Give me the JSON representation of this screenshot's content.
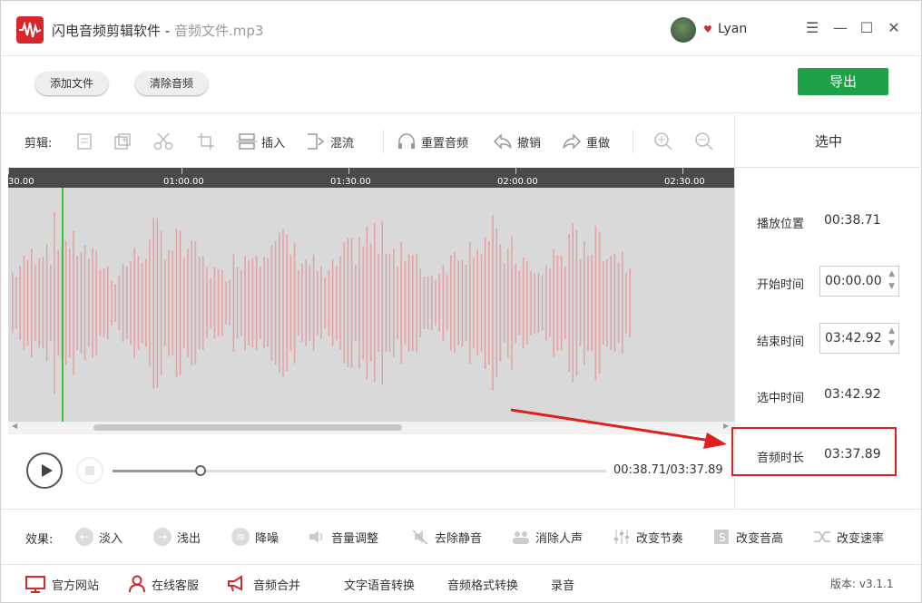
{
  "titlebar": {
    "app_name": "闪电音频剪辑软件",
    "separator": " - ",
    "file_name": "音频文件.mp3",
    "user": "Lyan",
    "minimize": "☰",
    "restore": "—",
    "maximize": "☐",
    "close": "✕"
  },
  "topbar": {
    "add_file": "添加文件",
    "clear_audio": "清除音频",
    "export": "导出"
  },
  "edit_toolbar": {
    "label": "剪辑:",
    "insert": "插入",
    "mix": "混流",
    "reset_audio": "重置音频",
    "undo": "撤销",
    "redo": "重做"
  },
  "ruler": {
    "ticks": [
      "30.00",
      "01:00.00",
      "01:30.00",
      "02:00.00",
      "02:30.00"
    ]
  },
  "transport": {
    "timecode": "00:38.71/03:37.89",
    "progress": 0.178
  },
  "panel": {
    "title": "选中",
    "play_position_label": "播放位置",
    "play_position_value": "00:38.71",
    "start_time_label": "开始时间",
    "start_time_value": "00:00.00",
    "end_time_label": "结束时间",
    "end_time_value": "03:42.92",
    "selected_time_label": "选中时间",
    "selected_time_value": "03:42.92",
    "duration_label": "音频时长",
    "duration_value": "03:37.89"
  },
  "effects": {
    "label": "效果:",
    "items": [
      "淡入",
      "浅出",
      "降噪",
      "音量调整",
      "去除静音",
      "消除人声",
      "改变节奏",
      "改变音高",
      "改变速率"
    ]
  },
  "footer": {
    "website": "官方网站",
    "support": "在线客服",
    "merge": "音频合并",
    "tts": "文字语音转换",
    "convert": "音频格式转换",
    "record": "录音",
    "version": "版本: v3.1.1"
  },
  "colors": {
    "accent_green": "#1fa247",
    "brand_red": "#d9262a",
    "wave_bar": "#e2a5a5",
    "highlight_red": "#e02020"
  }
}
